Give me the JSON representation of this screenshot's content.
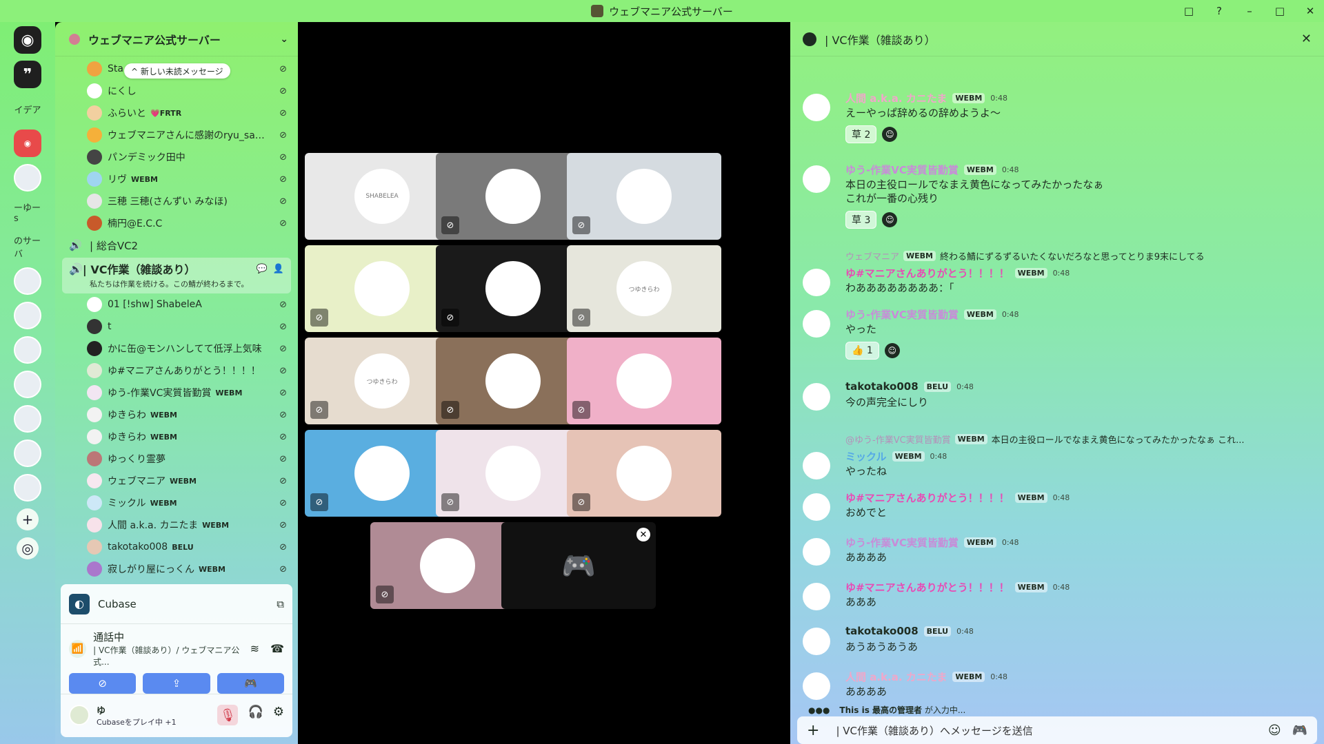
{
  "window": {
    "title": "ウェブマニア公式サーバー",
    "controls": [
      "□",
      "?",
      "–",
      "□",
      "✕"
    ]
  },
  "rail": {
    "items": [
      {
        "name": "discord-home",
        "label": "◉"
      },
      {
        "name": "server-quote",
        "label": "❞"
      },
      {
        "name": "server-idea",
        "label": "イデア"
      },
      {
        "name": "server-red",
        "label": "◉"
      },
      {
        "name": "server-avatar-1",
        "label": ""
      },
      {
        "name": "server-yuu",
        "label": "ーゆーs"
      },
      {
        "name": "server-saa",
        "label": "のサーバ"
      },
      {
        "name": "server-avatar-2",
        "label": ""
      },
      {
        "name": "server-avatar-3",
        "label": ""
      },
      {
        "name": "server-avatar-4",
        "label": ""
      },
      {
        "name": "server-avatar-5",
        "label": ""
      },
      {
        "name": "server-avatar-6",
        "label": ""
      },
      {
        "name": "server-avatar-7",
        "label": ""
      },
      {
        "name": "server-avatar-8",
        "label": ""
      },
      {
        "name": "add-server",
        "label": "+"
      },
      {
        "name": "explore",
        "label": "◎"
      }
    ]
  },
  "sidebar": {
    "server_name": "ウェブマニア公式サーバー",
    "unread_pill": "^ 新しい未読メッセージ",
    "top_users": [
      {
        "name": "Sta",
        "tag": "",
        "color": "#f0a341"
      },
      {
        "name": "にくし",
        "tag": "",
        "color": "#ffffff"
      },
      {
        "name": "ふらいと",
        "tag": "💗FRTR",
        "color": "#f2d0a0"
      },
      {
        "name": "ウェブマニアさんに感謝のryu_saz...",
        "tag": "",
        "color": "#f5b03a"
      },
      {
        "name": "パンデミック田中",
        "tag": "",
        "color": "#444"
      },
      {
        "name": "リヴ",
        "tag": "WEBM",
        "color": "#9fd5f0"
      },
      {
        "name": "三穂 三穂(さんずい みなほ)",
        "tag": "",
        "color": "#e6e6e6"
      },
      {
        "name": "楠円@E.C.C",
        "tag": "",
        "color": "#c85a2a"
      }
    ],
    "voice_channel_1": "| 総合VC2",
    "active_channel": {
      "name": "| VC作業（雑談あり）",
      "topic": "私たちは作業を続ける。この鯖が終わるまで。"
    },
    "vc_users": [
      {
        "name": "01 [!shw] ShabeleA",
        "tag": "",
        "color": "#ffffff"
      },
      {
        "name": "t",
        "tag": "",
        "color": "#333"
      },
      {
        "name": "かに缶@モンハンしてて低浮上気味",
        "tag": "",
        "color": "#222"
      },
      {
        "name": "ゆ#マニアさんありがとう！！！！",
        "tag": "",
        "color": "#e0ead5"
      },
      {
        "name": "ゆう-作業VC実質皆勤賞",
        "tag": "WEBM",
        "color": "#f2e6f2"
      },
      {
        "name": "ゆきらわ",
        "tag": "WEBM",
        "color": "#f2f2f2"
      },
      {
        "name": "ゆきらわ",
        "tag": "WEBM",
        "color": "#f2f2f2"
      },
      {
        "name": "ゆっくり霊夢",
        "tag": "",
        "color": "#b77"
      },
      {
        "name": "ウェブマニア",
        "tag": "WEBM",
        "color": "#f7e8f0"
      },
      {
        "name": "ミックル",
        "tag": "WEBM",
        "color": "#cde8f7"
      },
      {
        "name": "人間 a.k.a. カニたま",
        "tag": "WEBM",
        "color": "#f7e2ea"
      },
      {
        "name": "takotako008",
        "tag": "BELU",
        "color": "#e6c8b4"
      },
      {
        "name": "寂しがり屋にっくん",
        "tag": "WEBM",
        "color": "#a7c"
      }
    ]
  },
  "panel": {
    "activity": "Cubase",
    "voice_status": "通話中",
    "voice_sub": "| VC作業（雑談あり）/ ウェブマニア公式...",
    "user_name": "ゆ",
    "user_game": "Cubaseをプレイ中 +1"
  },
  "stage": {
    "tiles": [
      {
        "name": "tile-shabelea",
        "bg": "#e8e8e8",
        "label": "SHABELEA",
        "muted": false
      },
      {
        "name": "tile-t",
        "bg": "#7a7a7a",
        "label": "",
        "muted": true
      },
      {
        "name": "tile-kanikan",
        "bg": "#d5dbe0",
        "label": "",
        "muted": true
      },
      {
        "name": "tile-yu",
        "bg": "#e8f0c8",
        "label": "",
        "muted": true
      },
      {
        "name": "tile-yuu",
        "bg": "#1a1a1a",
        "label": "",
        "muted": true
      },
      {
        "name": "tile-yukirawa-1",
        "bg": "#e6e6dc",
        "label": "つゆきらわ",
        "muted": true
      },
      {
        "name": "tile-yukirawa-2",
        "bg": "#e6dccf",
        "label": "つゆきらわ",
        "muted": true
      },
      {
        "name": "tile-yukkuri",
        "bg": "#8a705a",
        "label": "",
        "muted": true
      },
      {
        "name": "tile-webmania",
        "bg": "#f0b0c8",
        "label": "",
        "muted": true
      },
      {
        "name": "tile-mikkuru",
        "bg": "#5aaee0",
        "label": "",
        "muted": true
      },
      {
        "name": "tile-kanitama",
        "bg": "#efe3ea",
        "label": "",
        "muted": true
      },
      {
        "name": "tile-takotako",
        "bg": "#e6c3b6",
        "label": "",
        "muted": true
      },
      {
        "name": "tile-nikkun",
        "bg": "#b08b95",
        "label": "",
        "muted": true
      },
      {
        "name": "tile-activity",
        "bg": "#111111",
        "label": "",
        "muted": false
      }
    ]
  },
  "chat": {
    "channel": "| VC作業（雑談あり）",
    "messages": [
      {
        "author": "人間 a.k.a. カニたま",
        "author_color": "#f0a7c9",
        "tag": "WEBM",
        "time": "0:48",
        "lines": [
          "えーやっぱ辞めるの辞めようよ〜"
        ],
        "reaction": "草 2"
      },
      {
        "author": "ゆう-作業VC実質皆勤賞",
        "author_color": "#c88bd8",
        "tag": "WEBM",
        "time": "0:48",
        "lines": [
          "本日の主役ロールでなまえ黄色になってみたかったなぁ",
          "これが一番の心残り"
        ],
        "reaction": "草 3"
      },
      {
        "reply_author": "ウェブマニア",
        "reply_tag": "WEBM",
        "reply_text": "終わる鯖にずるずるいたくないだろなと思ってとりま9末にしてる",
        "author": "ゆ#マニアさんありがとう！！！！",
        "author_color": "#e84bb5",
        "tag": "WEBM",
        "time": "0:48",
        "lines": [
          "わああああああああ：「"
        ]
      },
      {
        "author": "ゆう-作業VC実質皆勤賞",
        "author_color": "#c88bd8",
        "tag": "WEBM",
        "time": "0:48",
        "lines": [
          "やった"
        ],
        "reaction": "👍 1"
      },
      {
        "author": "takotako008",
        "author_color": "#1f2d22",
        "tag": "BELU",
        "time": "0:48",
        "lines": [
          "今の声完全にしり"
        ]
      },
      {
        "reply_author": "@ゆう-作業VC実質皆勤賞",
        "reply_tag": "WEBM",
        "reply_text": "本日の主役ロールでなまえ黄色になってみたかったなぁ これ...",
        "author": "ミックル",
        "author_color": "#55a9e6",
        "tag": "WEBM",
        "time": "0:48",
        "lines": [
          "やったね"
        ]
      },
      {
        "author": "ゆ#マニアさんありがとう！！！！",
        "author_color": "#e84bb5",
        "tag": "WEBM",
        "time": "0:48",
        "lines": [
          "おめでと"
        ]
      },
      {
        "author": "ゆう-作業VC実質皆勤賞",
        "author_color": "#c88bd8",
        "tag": "WEBM",
        "time": "0:48",
        "lines": [
          "ああああ"
        ]
      },
      {
        "author": "ゆ#マニアさんありがとう！！！！",
        "author_color": "#e84bb5",
        "tag": "WEBM",
        "time": "0:48",
        "lines": [
          "あああ"
        ]
      },
      {
        "author": "takotako008",
        "author_color": "#1f2d22",
        "tag": "BELU",
        "time": "0:48",
        "lines": [
          "あうあうあうあ"
        ]
      },
      {
        "author": "人間 a.k.a. カニたま",
        "author_color": "#f0a7c9",
        "tag": "WEBM",
        "time": "0:48",
        "lines": [
          "ああああ"
        ]
      }
    ],
    "typing_user": "This is 最高の管理者",
    "typing_suffix": "が入力中...",
    "input_placeholder": "| VC作業（雑談あり）へメッセージを送信"
  }
}
